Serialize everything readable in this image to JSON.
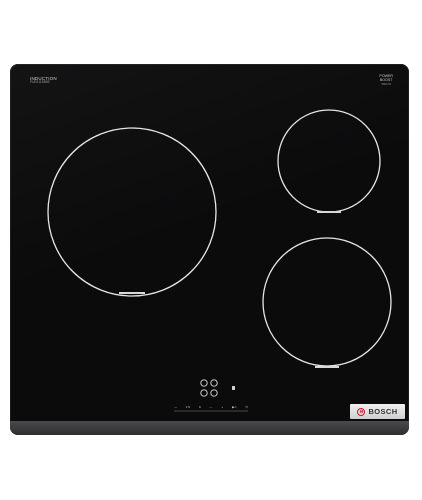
{
  "product": {
    "brand": "BOSCH",
    "label_top_left": "INDUCTION",
    "label_top_left_sub": "PUE611BB5E",
    "label_top_right_line1": "POWER",
    "label_top_right_line2": "BOOST",
    "label_top_right_sub": "3600 W"
  },
  "controls": {
    "strip_items": [
      "—",
      "1.5",
      "9",
      "—",
      "+",
      "▶⏲",
      "⏻"
    ]
  },
  "colors": {
    "glass": "#0b0b0c",
    "zone_ring": "#e6e6e6",
    "brand_red": "#d3132c",
    "frame": "#3a3a3c"
  },
  "icons": {
    "zone_marker": "heat-indicator",
    "flex_symbol": "four-circle-zone-icon",
    "lock": "child-lock-icon"
  }
}
